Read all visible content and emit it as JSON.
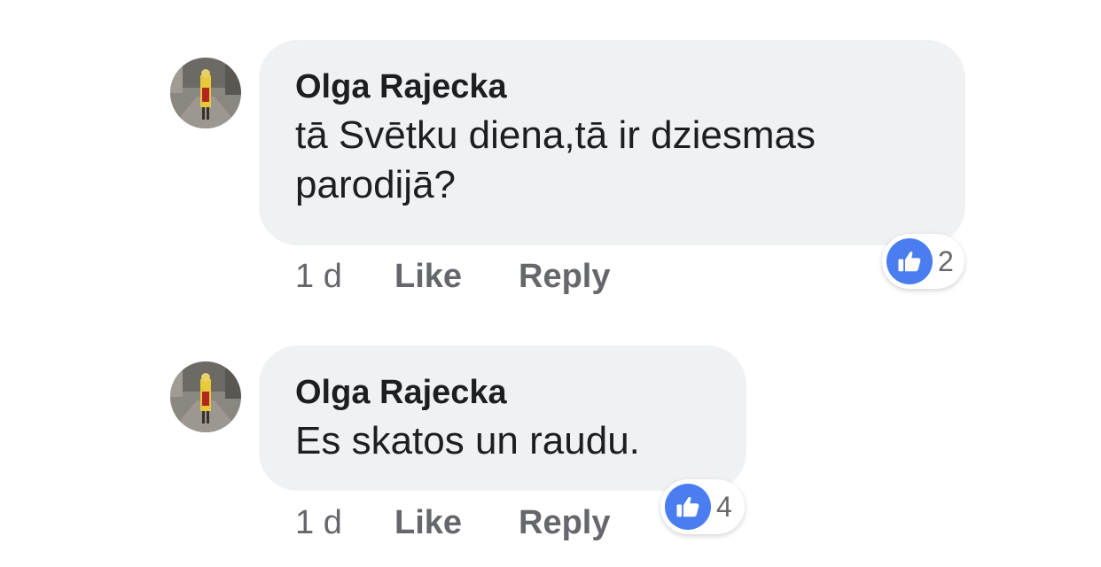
{
  "comments": [
    {
      "author": "Olga Rajecka",
      "text_lines": [
        "tā Svētku diena,tā ir dziesmas",
        "parodijā?"
      ],
      "time": "1 d",
      "like_label": "Like",
      "reply_label": "Reply",
      "reaction_icon": "thumbs-up-icon",
      "reaction_count": "2"
    },
    {
      "author": "Olga Rajecka",
      "text_lines": [
        "Es skatos un raudu."
      ],
      "time": "1 d",
      "like_label": "Like",
      "reply_label": "Reply",
      "reaction_icon": "thumbs-up-icon",
      "reaction_count": "4"
    }
  ],
  "colors": {
    "bubble": "#f0f1f3",
    "text": "#1c1e21",
    "secondary": "#65676b",
    "like_blue": "#4a7ef0"
  }
}
